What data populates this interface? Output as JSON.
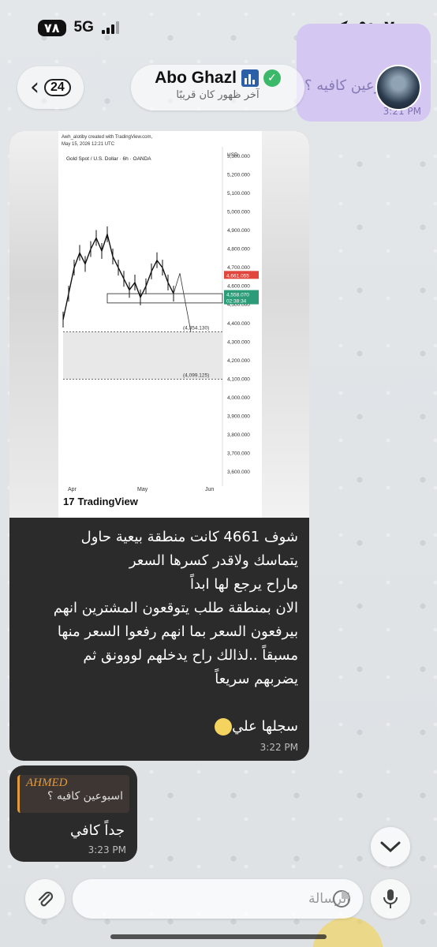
{
  "status_bar": {
    "battery": "٧٨",
    "network": "5G",
    "time": "٥:٠٢"
  },
  "header": {
    "unread_count": "24",
    "title": "Abo Ghazl",
    "subtitle": "آخر ظهور كان قريبًا"
  },
  "outgoing_preview": {
    "text": "بوعين كافيه ؟",
    "time": "3:21 PM"
  },
  "image_message": {
    "screenshot": {
      "author_line": "Awh_alotiby created with TradingView.com,",
      "date_line": "May 15, 2026 12:21 UTC",
      "symbol": "Gold Spot / U.S. Dollar · 6h · OANDA",
      "currency": "USD",
      "brand": "TradingView"
    },
    "text": "شوف 4661 كانت منطقة بيعية حاول\nيتماسك ولاقدر كسرها السعر\nماراح يرجع لها ابداً\nالان بمنطقة طلب يتوقعون المشترين انهم\nبيرفعون السعر بما انهم رفعوا السعر منها\nمسبقاً ..لذالك راح يدخلهم لووونق ثم\nيضربهم سريعاً",
    "text_tail": "سجلها علي",
    "time": "3:22 PM"
  },
  "chart_data": {
    "type": "line",
    "title": "Gold Spot / U.S. Dollar · 6h · OANDA",
    "ylabel": "USD",
    "ylim": [
      3600000,
      5300000
    ],
    "y_ticks": [
      "5,300.000",
      "5,200.000",
      "5,100.000",
      "5,000.000",
      "4,900.000",
      "4,800.000",
      "4,700.000",
      "4,600.000",
      "4,500.000",
      "4,400.000",
      "4,300.000",
      "4,200.000",
      "4,100.000",
      "4,000.000",
      "3,900.000",
      "3,800.000",
      "3,700.000",
      "3,600.000"
    ],
    "x_ticks": [
      "Apr",
      "May",
      "Jun"
    ],
    "price_labels": {
      "sell_level": "4,661.055",
      "last_price": "4,558.070",
      "countdown": "02:38:34"
    },
    "annotations": [
      "(4,354.130)",
      "(4,099.125)"
    ],
    "series": [
      {
        "values": [
          4420000,
          4560000,
          4700000,
          4780000,
          4720000,
          4800000,
          4860000,
          4790000,
          4880000,
          4760000,
          4700000,
          4640000,
          4580000,
          4620000,
          4540000,
          4600000,
          4680000,
          4740000,
          4700000,
          4620000,
          4560000
        ]
      }
    ],
    "projection": [
      4560000,
      4670000,
      4354130
    ],
    "colors": {
      "sell_tag": "#e0463b",
      "buy_tag": "#2b9b78",
      "zone": "#e8e8e8"
    }
  },
  "reply_message": {
    "quote_author": "AHMED",
    "quote_text": "اسبوعين كافيه ؟",
    "text": "جداً كافي",
    "time": "3:23 PM"
  },
  "composer": {
    "placeholder": "الرسالة"
  }
}
